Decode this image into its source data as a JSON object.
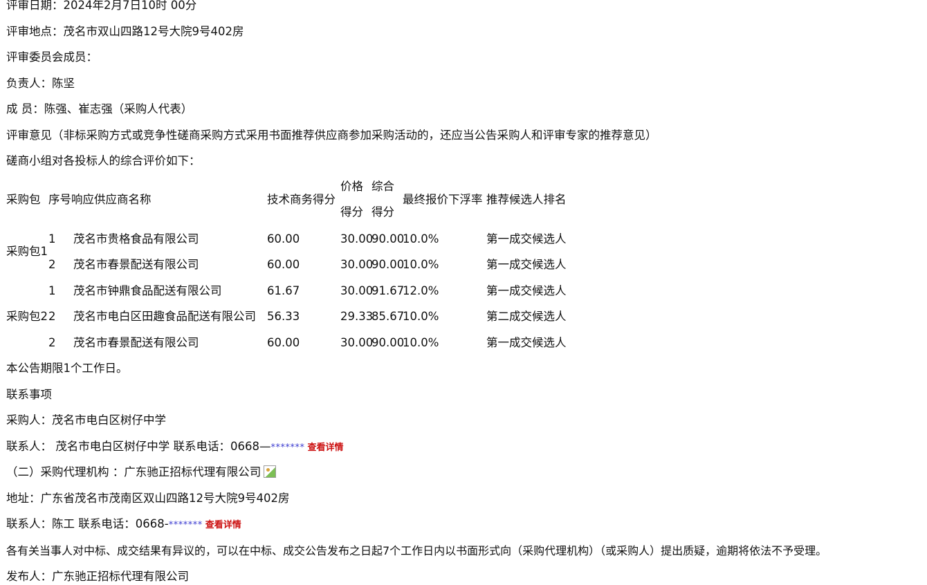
{
  "meta": {
    "review_date": "评审日期：2024年2月7日10时 00分",
    "review_place": "评审地点：茂名市双山四路12号大院9号402房",
    "committee": "评审委员会成员：",
    "leader": "负责人：陈坚",
    "members": "成 员：陈强、崔志强（采购人代表）",
    "opinion": "评审意见（非标采购方式或竞争性磋商采购方式采用书面推荐供应商参加采购活动的，还应当公告采购人和评审专家的推荐意见）",
    "evaluation_intro": "磋商小组对各投标人的综合评价如下："
  },
  "table": {
    "headers": {
      "package": "采购包",
      "seq": "序号",
      "supplier": "响应供应商名称",
      "tech": "技术商务得分",
      "price_a": "价格",
      "price_b": "得分",
      "total_a": "综合",
      "total_b": "得分",
      "float_rate": "最终报价下浮率",
      "rank": "推荐候选人排名"
    },
    "packages": [
      {
        "label": "采购包1"
      },
      {
        "label": "采购包2"
      }
    ],
    "rows": [
      {
        "seq": "1",
        "supplier": "茂名市贵格食品有限公司",
        "tech": "60.00",
        "price": "30.00",
        "total": "90.00",
        "rate": "10.0%",
        "rank": "第一成交候选人"
      },
      {
        "seq": "2",
        "supplier": "茂名市春景配送有限公司",
        "tech": "60.00",
        "price": "30.00",
        "total": "90.00",
        "rate": "10.0%",
        "rank": "第一成交候选人"
      },
      {
        "seq": "1",
        "supplier": "茂名市钟鼎食品配送有限公司",
        "tech": "61.67",
        "price": "30.00",
        "total": "91.67",
        "rate": "12.0%",
        "rank": "第一成交候选人"
      },
      {
        "seq": "2",
        "supplier": "茂名市电白区田趣食品配送有限公司",
        "tech": "56.33",
        "price": "29.33",
        "total": "85.67",
        "rate": "10.0%",
        "rank": "第二成交候选人"
      },
      {
        "seq": "2",
        "supplier": "茂名市春景配送有限公司",
        "tech": "60.00",
        "price": "30.00",
        "total": "90.00",
        "rate": "10.0%",
        "rank": "第一成交候选人"
      }
    ]
  },
  "footer": {
    "period": "本公告期限1个工作日。",
    "contact_heading": "联系事项",
    "purchaser": "采购人：茂名市电白区树仔中学",
    "purchaser_contact_prefix": "联系人：  茂名市电白区树仔中学 联系电话：0668—",
    "purchaser_phone_mask": "*******",
    "detail_link": "查看详情",
    "agency": "（二）采购代理机构 ：广东驰正招标代理有限公司",
    "agency_address": "地址：广东省茂名市茂南区双山四路12号大院9号402房",
    "agency_contact_prefix": "联系人：陈工 联系电话：0668-",
    "agency_phone_mask": "*******",
    "objection": "各有关当事人对中标、成交结果有异议的，可以在中标、成交公告发布之日起7个工作日内以书面形式向（采购代理机构）（或采购人）提出质疑，逾期将依法不予受理。",
    "publisher": "发布人：广东驰正招标代理有限公司"
  }
}
